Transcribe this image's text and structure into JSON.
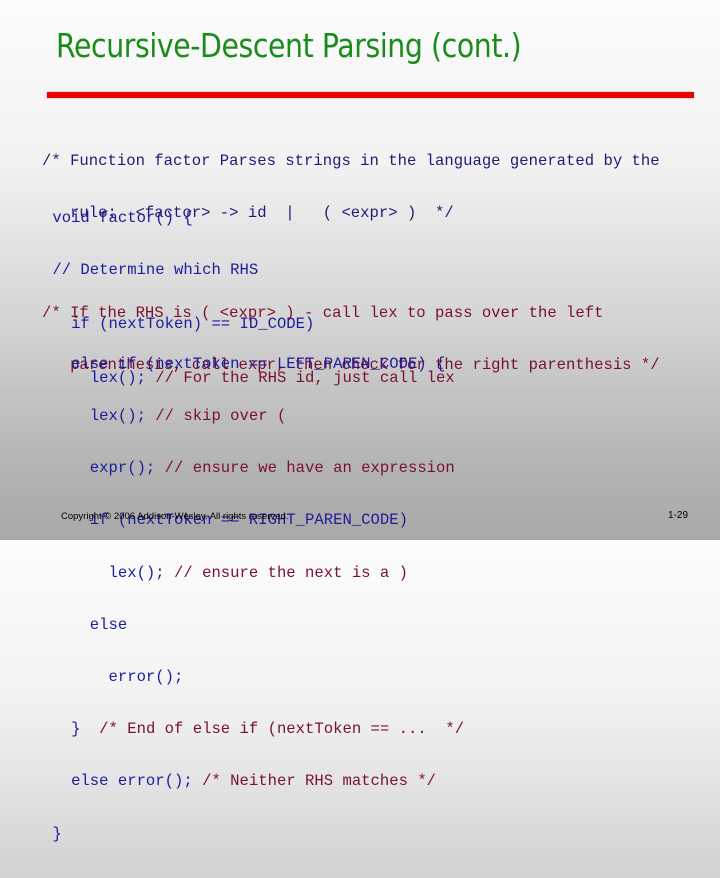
{
  "slide": {
    "title": "Recursive-Descent Parsing (cont.)",
    "comment1": [
      "/* Function factor Parses strings in the language generated by the",
      "   rule:  <factor> -> id  |   ( <expr> )  */"
    ],
    "code1": [
      {
        "code": " void factor() {",
        "comment": ""
      },
      {
        "code": " // Determine which RHS",
        "comment": ""
      },
      {
        "code": "   if (nextToken) == ID_CODE)",
        "comment": ""
      },
      {
        "code": "     lex(); ",
        "comment": "// For the RHS id, just call lex"
      }
    ],
    "comment2": [
      "/* If the RHS is ( <expr> ) - call lex to pass over the left",
      "   parenthesis, call expr, then check for the right parenthesis */"
    ],
    "code2": [
      {
        "code": "   else if (nextToken == LEFT_PAREN_CODE) {",
        "comment": ""
      },
      {
        "code": "     lex(); ",
        "comment": "// skip over ("
      },
      {
        "code": "     expr(); ",
        "comment": "// ensure we have an expression"
      },
      {
        "code": "     if (nextToken == RIGHT_PAREN_CODE)",
        "comment": ""
      },
      {
        "code": "       lex(); ",
        "comment": "// ensure the next is a )"
      },
      {
        "code": "     else",
        "comment": ""
      },
      {
        "code": "       error();",
        "comment": ""
      },
      {
        "code": "   }  ",
        "comment": "/* End of else if (nextToken == ...  */"
      },
      {
        "code": "   else error(); ",
        "comment": "/* Neither RHS matches */"
      },
      {
        "code": " }",
        "comment": ""
      }
    ]
  },
  "footer": {
    "copyright": "Copyright © 2006 Addison-Wesley. All rights reserved.",
    "page_number": "1-29"
  },
  "colors": {
    "title": "#1a8c1a",
    "rule": "#e60000",
    "code": "#1c1c9c",
    "comment": "#7a1030"
  }
}
